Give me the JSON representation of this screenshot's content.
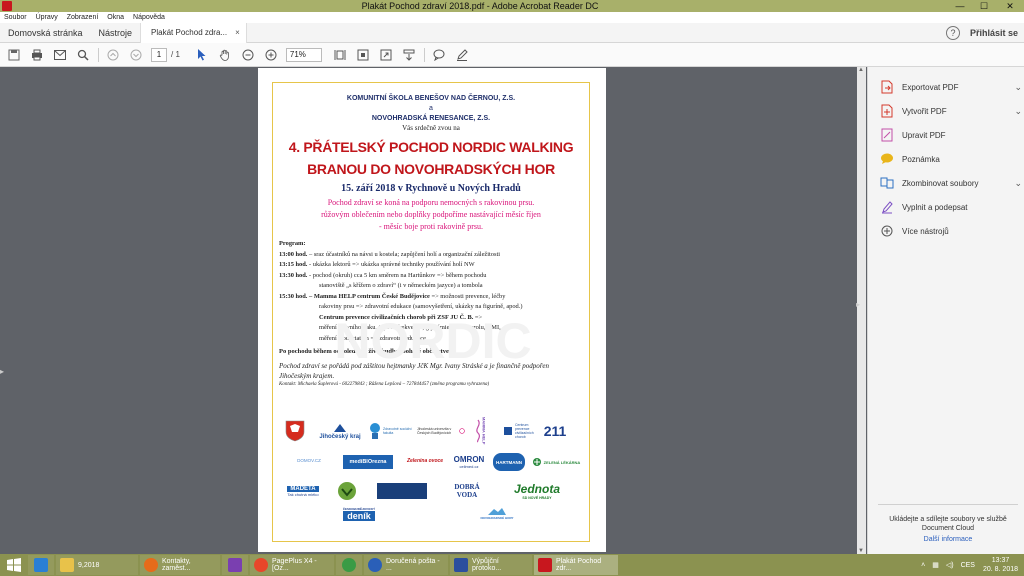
{
  "window": {
    "title": "Plakát Pochod zdraví 2018.pdf - Adobe Acrobat Reader DC",
    "min": "—",
    "max": "☐",
    "close": "✕"
  },
  "menu": [
    "Soubor",
    "Úpravy",
    "Zobrazení",
    "Okna",
    "Nápověda"
  ],
  "tabs": {
    "home": "Domovská stránka",
    "tools": "Nástroje",
    "doc": "Plakát Pochod zdra...",
    "doc_close": "×",
    "help": "?",
    "signin": "Přihlásit se"
  },
  "toolbar": {
    "page_current": "1",
    "page_total": "/ 1",
    "zoom": "71%"
  },
  "poster": {
    "org1": "KOMUNITNÍ ŠKOLA BENEŠOV NAD ČERNOU, Z.S.",
    "amp": "a",
    "org2": "NOVOHRADSKÁ RENESANCE, Z.S.",
    "invite": "Vás srdečně zvou na",
    "head1": "4. PŘÁTELSKÝ POCHOD NORDIC WALKING",
    "head2": "BRANOU DO NOVOHRADSKÝCH HOR",
    "date": "15. září 2018 v Rychnově u Nových Hradů",
    "pink1": "Pochod zdraví se koná na podporu nemocných s rakovinou prsu.",
    "pink2": "růžovým oblečením nebo doplňky podpoříme nastávající měsíc říjen",
    "pink3": "- měsíc boje proti rakovině prsu.",
    "program_label": "Program:",
    "p1_time": "13:00 hod.",
    "p1_text": " – sraz účastníků na návsi u kostela; zapůjčení holí a organizační záležitosti",
    "p2_time": "13:15 hod.",
    "p2_text": " - ukázka lektorů => ukázka správné techniky používání holí NW",
    "p3_time": "13:30 hod.",
    "p3_text": " - pochod (okruh) cca 5 km směrem na Hartůnkov => během pochodu",
    "p3_cont": "stanoviště „s křížem o zdraví“ (i v německém jazyce) a tombola",
    "p4_time": "15:30 hod.",
    "p4_bold": " – Mamma HELP centrum České Budějovice",
    "p4_text": " => možnosti prevence, léčby",
    "p4_cont": "rakoviny prsu => zdravotní edukace (samovyšetření, ukázky na figuríně, apod.)",
    "p5_bold": "Centrum prevence civilizačních chorob při ZSF JU Č. B.",
    "p5_text": " =>",
    "p5_cont1": "měření krevního tlaku, tepové frekvence, glykémie, cholesterolu, BMI,",
    "p5_cont2": "měření Bodystatem => zdravotní edukace",
    "after": "Po pochodu během odpoledne – živá hudba, bohaté občerstvení",
    "italic": "Pochod zdraví se pořádá pod záštitou hejtmanky JčK Mgr. Ivany Stráské a je finančně podpořen Jihočeským krajem.",
    "contact": "Kontakt: Michaela Šuplerová - 602279843 ; Růžena Lepšová – 727844457 (změna programu vyhrazena)",
    "logos": {
      "kraj": "Jihočeský kraj",
      "zsf": "Zdravotně sociální fakulta",
      "jihoceska_u": "Jihočeská univerzita v Českých Budějovicích",
      "mamma": "MAMMA HELP",
      "prevence": "Centrum prevence civilizačních chorob",
      "n211": "211",
      "domovcz": "DOMOV.CZ",
      "medibio": "mediBIOrezna",
      "zelenina": "Zelenina ovoce",
      "omron": "OMRON",
      "omron_sub": "celimed.cz",
      "hartmann": "HARTMANN",
      "lekarna": "ZELENÁ LÉKÁRNA",
      "madeta": "MADETA",
      "madeta_sub": "Tak chutná mléko",
      "dobra_voda": "DOBRÁ VODA",
      "jednota": "Jednota",
      "jednota_sub": "SD NOVÉ HRADY",
      "denik": "deník",
      "denik_sup": "ČESKOBUDĚJOVICKÝ",
      "novohrady": "NOVOHRADSKÉ HORY"
    },
    "watermark": "NORDIC"
  },
  "tools_pane": {
    "items": [
      {
        "label": "Exportovat PDF",
        "chev": "⌄",
        "icon_color": "#d33a2c"
      },
      {
        "label": "Vytvořit PDF",
        "chev": "⌄",
        "icon_color": "#d33a2c"
      },
      {
        "label": "Upravit PDF",
        "chev": "",
        "icon_color": "#c24fa8"
      },
      {
        "label": "Poznámka",
        "chev": "",
        "icon_color": "#e9b51a"
      },
      {
        "label": "Zkombinovat soubory",
        "chev": "⌄",
        "icon_color": "#2b6fc2"
      },
      {
        "label": "Vyplnit a podepsat",
        "chev": "",
        "icon_color": "#7c4fc4"
      },
      {
        "label": "Více nástrojů",
        "chev": "",
        "icon_color": "#555555"
      }
    ],
    "cloud_text": "Ukládejte a sdílejte soubory ve službě Document Cloud",
    "cloud_link": "Další informace"
  },
  "taskbar": {
    "items": [
      {
        "label": "",
        "color": "#2a7fd4"
      },
      {
        "label": "9,2018",
        "color": "#e8c24a"
      },
      {
        "label": "Kontakty, zaměst...",
        "color": "#e66b1a"
      },
      {
        "label": "",
        "color": "#7a3fb0"
      },
      {
        "label": "PagePlus X4 - [Oz...",
        "color": "#e8462a"
      },
      {
        "label": "",
        "color": "#3a9b45"
      },
      {
        "label": "Doručená pošta - ...",
        "color": "#2a5fb8"
      },
      {
        "label": "Výpůjční protoko...",
        "color": "#2b4f9e"
      },
      {
        "label": "Plakát Pochod zdr...",
        "color": "#c8171e"
      }
    ],
    "lang": "CES",
    "time": "13:37",
    "date": "20. 8. 2018"
  }
}
